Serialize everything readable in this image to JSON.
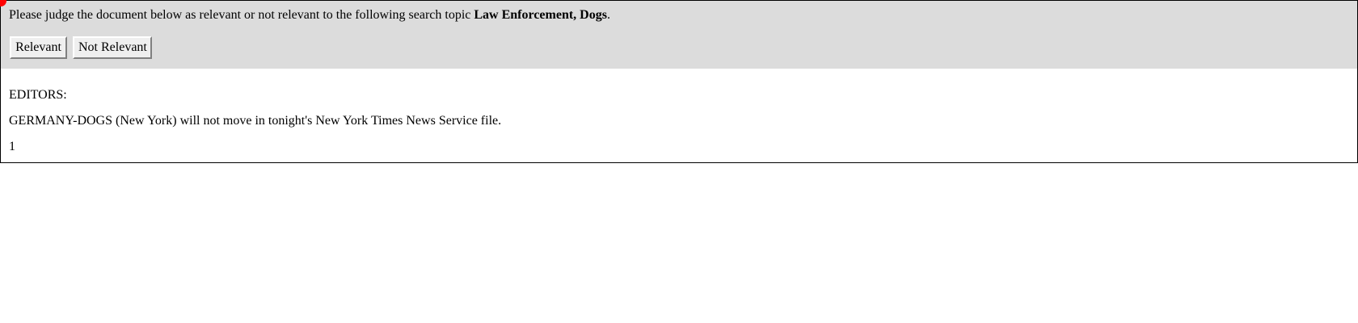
{
  "prompt": {
    "text_before": "Please judge the document below as relevant or not relevant to the following search topic ",
    "topic": "Law Enforcement, Dogs",
    "text_after": "."
  },
  "buttons": {
    "relevant_label": "Relevant",
    "not_relevant_label": "Not Relevant"
  },
  "document": {
    "lines": [
      "EDITORS:",
      "GERMANY-DOGS (New York) will not move in tonight's New York Times News Service file.",
      "1"
    ]
  },
  "colors": {
    "panel_background": "#dcdcdc",
    "pointer": "#ff0000"
  }
}
